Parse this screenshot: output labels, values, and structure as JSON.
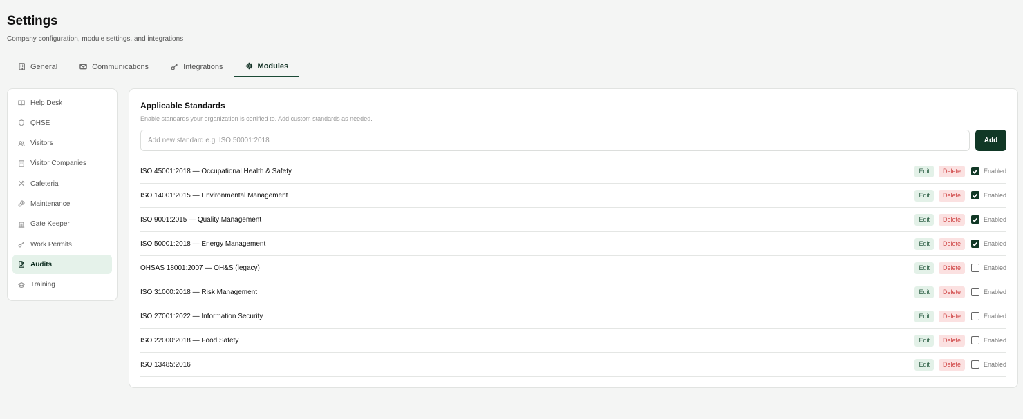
{
  "page": {
    "title": "Settings",
    "subtitle": "Company configuration, module settings, and integrations"
  },
  "tabs": [
    {
      "label": "General",
      "icon": "building-icon",
      "active": false
    },
    {
      "label": "Communications",
      "icon": "mail-icon",
      "active": false
    },
    {
      "label": "Integrations",
      "icon": "key-icon",
      "active": false
    },
    {
      "label": "Modules",
      "icon": "gear-icon",
      "active": true
    }
  ],
  "sidebar": {
    "items": [
      {
        "label": "Help Desk",
        "icon": "book-icon",
        "active": false
      },
      {
        "label": "QHSE",
        "icon": "shield-icon",
        "active": false
      },
      {
        "label": "Visitors",
        "icon": "users-icon",
        "active": false
      },
      {
        "label": "Visitor Companies",
        "icon": "building-icon",
        "active": false
      },
      {
        "label": "Cafeteria",
        "icon": "utensils-icon",
        "active": false
      },
      {
        "label": "Maintenance",
        "icon": "wrench-icon",
        "active": false
      },
      {
        "label": "Gate Keeper",
        "icon": "gate-icon",
        "active": false
      },
      {
        "label": "Work Permits",
        "icon": "key-icon",
        "active": false
      },
      {
        "label": "Audits",
        "icon": "clipboard-icon",
        "active": true
      },
      {
        "label": "Training",
        "icon": "graduation-cap-icon",
        "active": false
      }
    ]
  },
  "standards_section": {
    "title": "Applicable Standards",
    "description": "Enable standards your organization is certified to. Add custom standards as needed.",
    "input_placeholder": "Add new standard e.g. ISO 50001:2018",
    "input_value": "",
    "add_label": "Add",
    "edit_label": "Edit",
    "delete_label": "Delete",
    "enabled_label": "Enabled",
    "standards": [
      {
        "name": "ISO 45001:2018 — Occupational Health & Safety",
        "enabled": true
      },
      {
        "name": "ISO 14001:2015 — Environmental Management",
        "enabled": true
      },
      {
        "name": "ISO 9001:2015 — Quality Management",
        "enabled": true
      },
      {
        "name": "ISO 50001:2018 — Energy Management",
        "enabled": true
      },
      {
        "name": "OHSAS 18001:2007 — OH&S (legacy)",
        "enabled": false
      },
      {
        "name": "ISO 31000:2018 — Risk Management",
        "enabled": false
      },
      {
        "name": "ISO 27001:2022 — Information Security",
        "enabled": false
      },
      {
        "name": "ISO 22000:2018 — Food Safety",
        "enabled": false
      },
      {
        "name": "ISO 13485:2016",
        "enabled": false
      }
    ]
  },
  "colors": {
    "accent": "#113826",
    "active_bg": "#e5f2ea",
    "edit_bg": "#e3f1e8",
    "delete_bg": "#fbe1e1",
    "delete_text": "#d04848"
  }
}
